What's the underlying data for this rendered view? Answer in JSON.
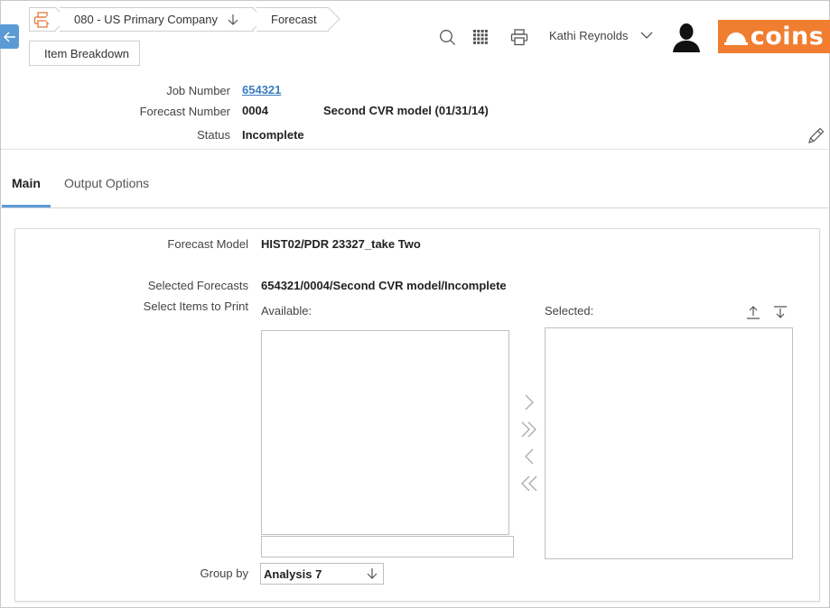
{
  "breadcrumbs": {
    "company": "080 - US Primary Company",
    "forecast": "Forecast",
    "item_breakdown": "Item Breakdown"
  },
  "user": {
    "name": "Kathi Reynolds"
  },
  "logo": {
    "text": "coins",
    "color": "#f07d30"
  },
  "header": {
    "job_number_label": "Job Number",
    "job_number_value": "654321",
    "forecast_number_label": "Forecast Number",
    "forecast_number_value": "0004",
    "forecast_description": "Second CVR model (01/31/14)",
    "status_label": "Status",
    "status_value": "Incomplete"
  },
  "tabs": [
    {
      "label": "Main",
      "active": true
    },
    {
      "label": "Output Options",
      "active": false
    }
  ],
  "form": {
    "forecast_model_label": "Forecast Model",
    "forecast_model_value": "HIST02/PDR 23327_take Two",
    "selected_forecasts_label": "Selected Forecasts",
    "selected_forecasts_value": "654321/0004/Second CVR model/Incomplete",
    "select_items_label": "Select Items to Print",
    "available_label": "Available:",
    "selected_label": "Selected:",
    "available_filter_value": "",
    "group_by_label": "Group by",
    "group_by_value": "Analysis 7"
  },
  "colors": {
    "accent": "#5b9bd5",
    "brand": "#f07d30",
    "link": "#3a7dbf"
  },
  "icons": [
    "back-arrow-icon",
    "print-icon",
    "search-icon",
    "apps-grid-icon",
    "user-avatar-icon",
    "edit-pencil-icon",
    "move-up-icon",
    "move-down-icon"
  ]
}
